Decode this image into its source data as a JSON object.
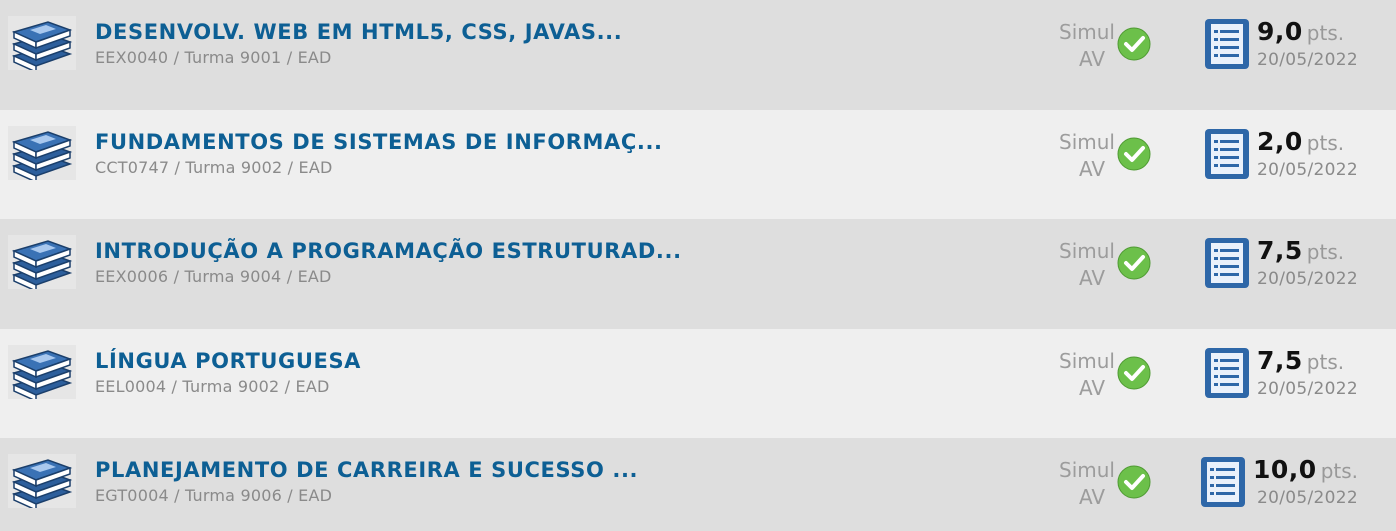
{
  "courses": [
    {
      "title": "DESENVOLV. WEB EM HTML5, CSS, JAVAS...",
      "subtitle": "EEX0040 / Turma 9001 / EAD",
      "simul_label": "Simul",
      "av_label": "AV",
      "score": "9,0",
      "score_unit": "pts.",
      "date": "20/05/2022"
    },
    {
      "title": "FUNDAMENTOS DE SISTEMAS DE INFORMAÇ...",
      "subtitle": "CCT0747 / Turma 9002 / EAD",
      "simul_label": "Simul",
      "av_label": "AV",
      "score": "2,0",
      "score_unit": "pts.",
      "date": "20/05/2022"
    },
    {
      "title": "INTRODUÇÃO A PROGRAMAÇÃO ESTRUTURAD...",
      "subtitle": "EEX0006 / Turma 9004 / EAD",
      "simul_label": "Simul",
      "av_label": "AV",
      "score": "7,5",
      "score_unit": "pts.",
      "date": "20/05/2022"
    },
    {
      "title": "LÍNGUA PORTUGUESA",
      "subtitle": "EEL0004 / Turma 9002 / EAD",
      "simul_label": "Simul",
      "av_label": "AV",
      "score": "7,5",
      "score_unit": "pts.",
      "date": "20/05/2022"
    },
    {
      "title": "PLANEJAMENTO DE CARREIRA E SUCESSO ...",
      "subtitle": "EGT0004 / Turma 9006 / EAD",
      "simul_label": "Simul",
      "av_label": "AV",
      "score": "10,0",
      "score_unit": "pts.",
      "date": "20/05/2022"
    }
  ],
  "icons": {
    "course": "books-stack-icon",
    "status": "green-check-icon",
    "grade": "notepad-list-icon"
  },
  "colors": {
    "title": "#0d5f94",
    "check_green": "#6cc04a",
    "row_dark": "#dedede",
    "row_light": "#efefef"
  }
}
